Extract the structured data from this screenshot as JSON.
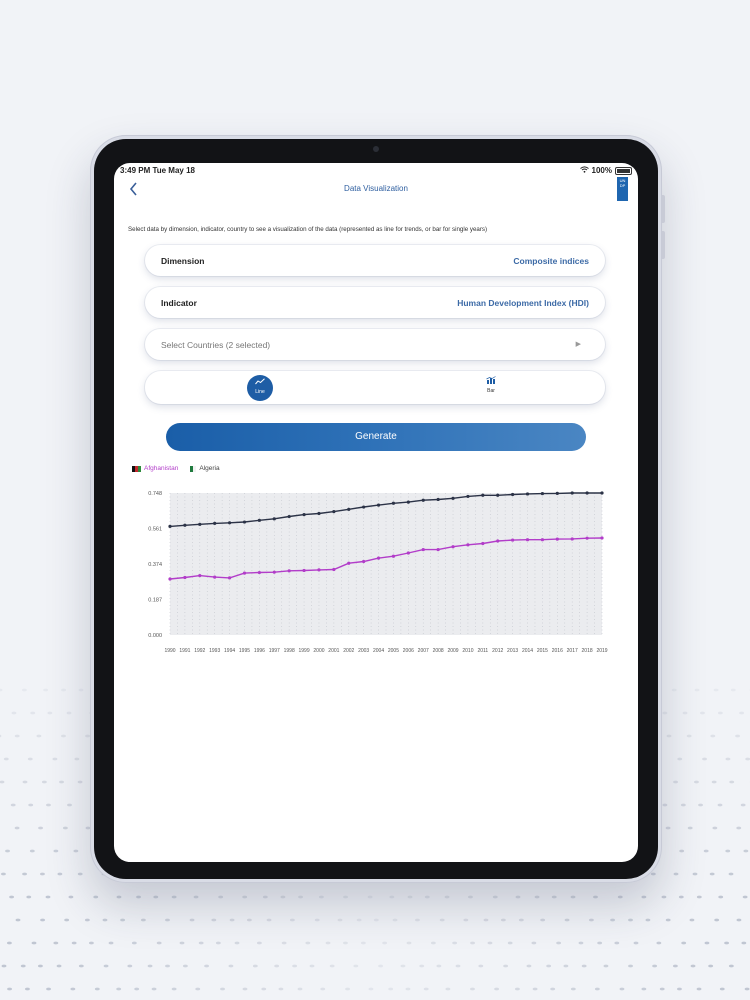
{
  "status_bar": {
    "time": "3:49 PM  Tue May 18",
    "battery": "100%"
  },
  "nav": {
    "back_icon": "chevron-left-icon",
    "title": "Data Visualization",
    "logo_text": "UN DP"
  },
  "intro": "Select data by dimension, indicator, country to see a visualization of the data (represented as line for trends, or bar for single years)",
  "dimension": {
    "label": "Dimension",
    "value": "Composite indices"
  },
  "indicator": {
    "label": "Indicator",
    "value": "Human Development Index (HDI)"
  },
  "countries": {
    "placeholder": "Select Countries (2 selected)"
  },
  "chart_type": {
    "selected": "Line",
    "options": [
      {
        "label": "Line",
        "icon": "line-chart-icon"
      },
      {
        "label": "Bar",
        "icon": "bar-chart-icon"
      }
    ]
  },
  "generate_label": "Generate",
  "colors": {
    "afghanistan": "#b23dc9",
    "algeria": "#2c3347",
    "accent": "#1e5da5"
  },
  "chart_data": {
    "type": "line",
    "x": [
      1990,
      1991,
      1992,
      1993,
      1994,
      1995,
      1996,
      1997,
      1998,
      1999,
      2000,
      2001,
      2002,
      2003,
      2004,
      2005,
      2006,
      2007,
      2008,
      2009,
      2010,
      2011,
      2012,
      2013,
      2014,
      2015,
      2016,
      2017,
      2018,
      2019
    ],
    "series": [
      {
        "name": "Afghanistan",
        "values": [
          0.295,
          0.303,
          0.313,
          0.305,
          0.301,
          0.326,
          0.329,
          0.331,
          0.338,
          0.34,
          0.343,
          0.345,
          0.378,
          0.387,
          0.405,
          0.415,
          0.432,
          0.45,
          0.45,
          0.465,
          0.475,
          0.482,
          0.495,
          0.5,
          0.502,
          0.502,
          0.505,
          0.506,
          0.51,
          0.511
        ]
      },
      {
        "name": "Algeria",
        "values": [
          0.572,
          0.578,
          0.583,
          0.588,
          0.591,
          0.595,
          0.604,
          0.612,
          0.624,
          0.634,
          0.64,
          0.65,
          0.662,
          0.674,
          0.684,
          0.694,
          0.7,
          0.71,
          0.714,
          0.72,
          0.73,
          0.736,
          0.736,
          0.74,
          0.743,
          0.745,
          0.746,
          0.748,
          0.748,
          0.748
        ]
      }
    ],
    "yticks": [
      "0.748",
      "0.561",
      "0.374",
      "0.187",
      "0.000"
    ],
    "ylim": [
      0,
      0.748
    ],
    "legend": "top-left"
  }
}
